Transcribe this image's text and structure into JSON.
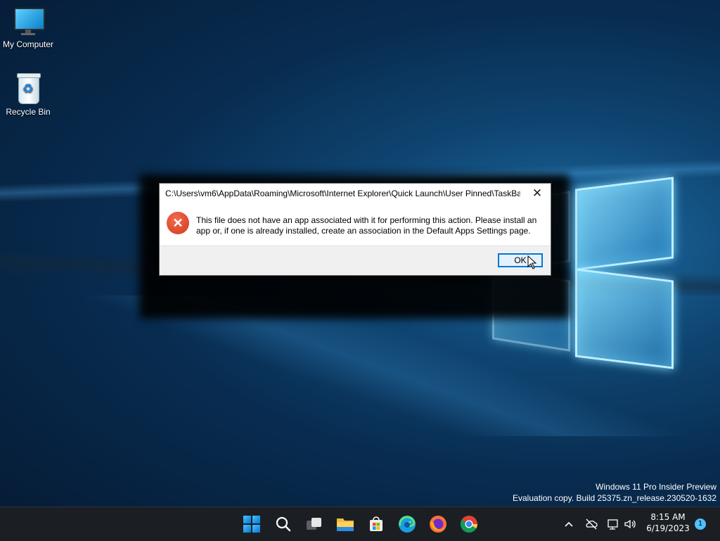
{
  "desktop": {
    "icons": [
      {
        "label": "My Computer",
        "icon": "monitor-icon"
      },
      {
        "label": "Recycle Bin",
        "icon": "recycle-bin-icon"
      }
    ]
  },
  "dialog": {
    "title": "C:\\Users\\vm6\\AppData\\Roaming\\Microsoft\\Internet Explorer\\Quick Launch\\User Pinned\\TaskBa...",
    "message": "This file does not have an app associated with it for performing this action. Please install an app or, if one is already installed, create an association in the Default Apps Settings page.",
    "ok_label": "OK",
    "close_glyph": "✕",
    "error_glyph": "✕",
    "error_color": "#e0492a"
  },
  "watermark": {
    "line1": "Windows 11 Pro Insider Preview",
    "line2": "Evaluation copy. Build 25375.zn_release.230520-1632"
  },
  "taskbar": {
    "apps": [
      "start-icon",
      "search-icon",
      "task-view-icon",
      "file-explorer-icon",
      "microsoft-store-icon",
      "edge-icon",
      "firefox-icon",
      "chrome-icon"
    ],
    "tray": {
      "chevron": "^",
      "time": "8:15 AM",
      "date": "6/19/2023",
      "notification_count": "1"
    }
  }
}
